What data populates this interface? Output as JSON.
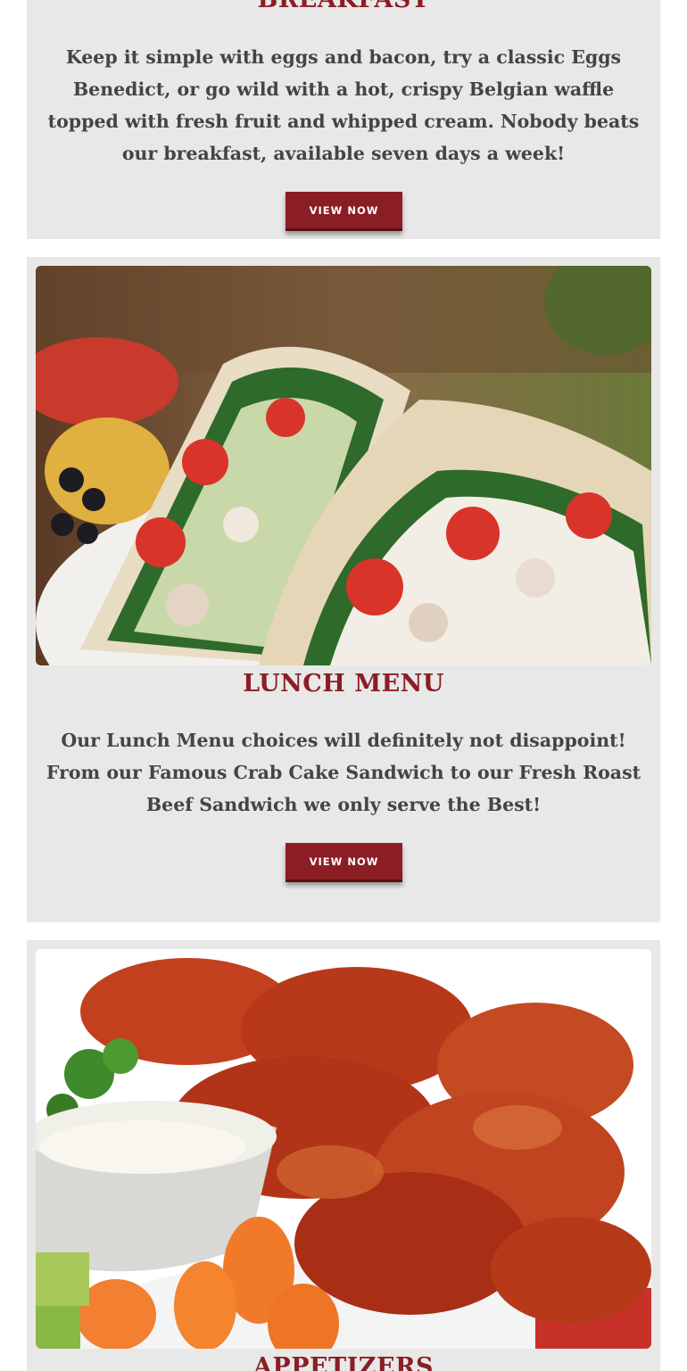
{
  "breakfast": {
    "title": "BREAKFAST",
    "description": "Keep it simple with eggs and bacon, try a classic Eggs Benedict, or go wild with a hot, crispy Belgian waffle topped with fresh fruit and whipped cream. Nobody beats our breakfast, available seven days a week!",
    "button_label": "VIEW NOW"
  },
  "lunch": {
    "title": "LUNCH MENU",
    "description": "Our Lunch Menu choices will definitely not disappoint! From our Famous Crab Cake Sandwich to our Fresh Roast Beef Sandwich we only serve the Best!",
    "button_label": "VIEW NOW",
    "image_icon": "wrap-sandwich-photo"
  },
  "appetizers": {
    "title": "APPETIZERS",
    "image_icon": "buffalo-wings-photo"
  },
  "colors": {
    "accent": "#8b1e24",
    "card_background": "#e8e8e8",
    "body_text": "#444444"
  }
}
